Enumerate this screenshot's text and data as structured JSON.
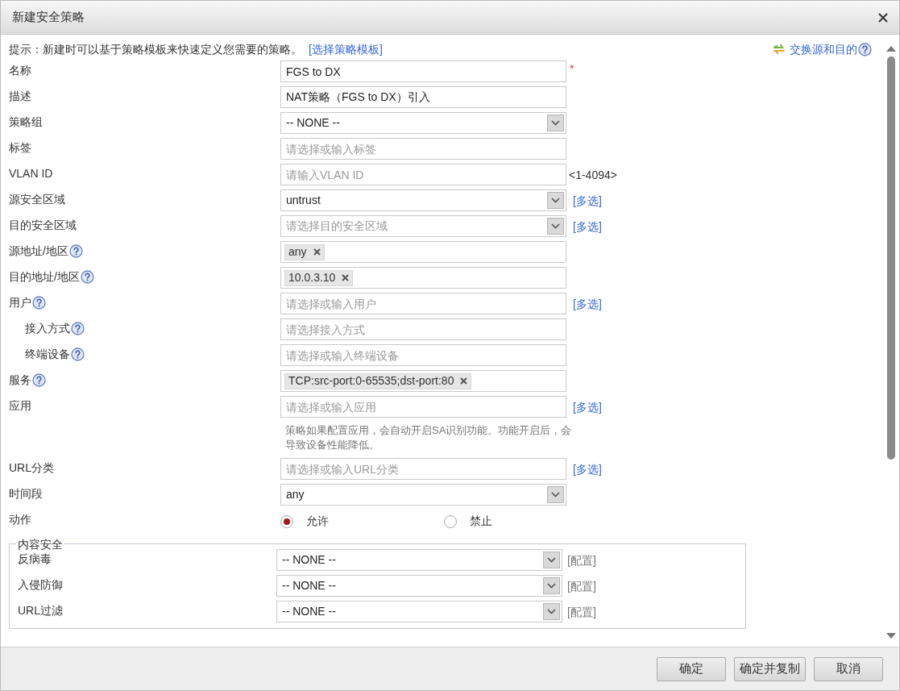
{
  "window": {
    "title": "新建安全策略"
  },
  "hint": {
    "text": "提示：新建时可以基于策略模板来快速定义您需要的策略。",
    "link": "[选择策略模板]"
  },
  "swap_link": {
    "text": "交换源和目的",
    "help": true
  },
  "fields": [
    {
      "label": "名称",
      "kind": "text",
      "value": "FGS to DX",
      "required_mark": "*"
    },
    {
      "label": "描述",
      "kind": "text",
      "value": "NAT策略（FGS to DX）引入"
    },
    {
      "label": "策略组",
      "kind": "select",
      "value": "-- NONE --"
    },
    {
      "label": "标签",
      "kind": "text",
      "placeholder": "请选择或输入标签"
    },
    {
      "label": "VLAN ID",
      "kind": "text",
      "placeholder": "请输入VLAN ID",
      "suffix": {
        "text": "<1-4094>",
        "kind": "hint"
      }
    },
    {
      "label": "源安全区域",
      "kind": "select",
      "value": "untrust",
      "suffix": {
        "text": "[多选]",
        "kind": "link"
      }
    },
    {
      "label": "目的安全区域",
      "kind": "select",
      "placeholder": "请选择目的安全区域",
      "suffix": {
        "text": "[多选]",
        "kind": "link"
      }
    },
    {
      "label": "源地址/地区",
      "help": true,
      "kind": "tags",
      "tags": [
        "any"
      ]
    },
    {
      "label": "目的地址/地区",
      "help": true,
      "kind": "tags",
      "tags": [
        "10.0.3.10"
      ]
    },
    {
      "label": "用户",
      "help": true,
      "kind": "text",
      "placeholder": "请选择或输入用户",
      "suffix": {
        "text": "[多选]",
        "kind": "link"
      },
      "children": [
        {
          "label": "接入方式",
          "help": true,
          "kind": "text",
          "placeholder": "请选择接入方式"
        },
        {
          "label": "终端设备",
          "help": true,
          "kind": "text",
          "placeholder": "请选择或输入终端设备"
        }
      ]
    },
    {
      "label": "服务",
      "help": true,
      "kind": "tags",
      "tags": [
        "TCP:src-port:0-65535;dst-port:80"
      ]
    },
    {
      "label": "应用",
      "kind": "text",
      "placeholder": "请选择或输入应用",
      "suffix": {
        "text": "[多选]",
        "kind": "link"
      }
    },
    {
      "kind": "note",
      "text": "策略如果配置应用，会自动开启SA识别功能。功能开启后，会导致设备性能降低。"
    },
    {
      "label": "URL分类",
      "kind": "text",
      "placeholder": "请选择或输入URL分类",
      "suffix": {
        "text": "[多选]",
        "kind": "link"
      }
    },
    {
      "label": "时间段",
      "kind": "select",
      "value": "any"
    },
    {
      "label": "动作",
      "kind": "radio",
      "options": [
        {
          "label": "允许",
          "selected": true
        },
        {
          "label": "禁止",
          "selected": false
        }
      ]
    }
  ],
  "content_security": {
    "legend": "内容安全",
    "rows": [
      {
        "label": "反病毒",
        "value": "-- NONE --",
        "link": "[配置]"
      },
      {
        "label": "入侵防御",
        "value": "-- NONE --",
        "link": "[配置]"
      },
      {
        "label": "URL过滤",
        "value": "-- NONE --",
        "link": "[配置]"
      }
    ]
  },
  "buttons": [
    {
      "label": "确定"
    },
    {
      "label": "确定并复制"
    },
    {
      "label": "取消"
    }
  ]
}
